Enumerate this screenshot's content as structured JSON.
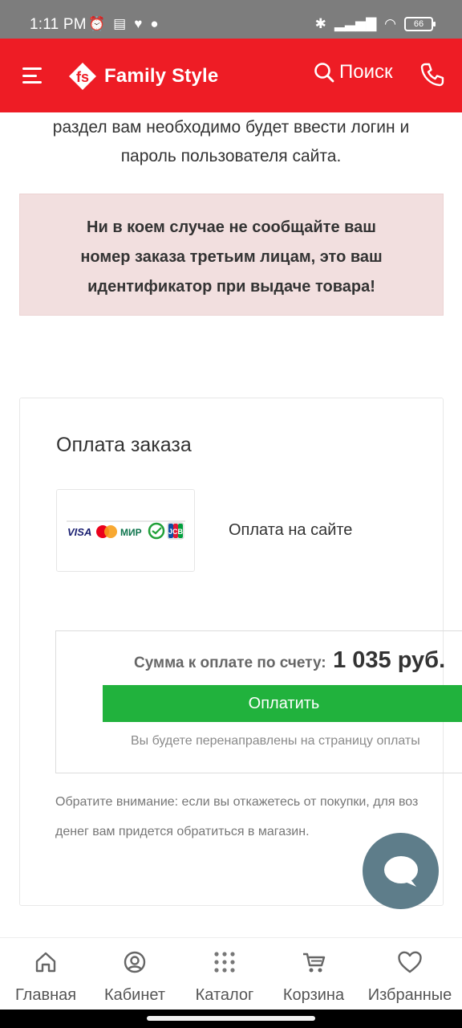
{
  "status_bar": {
    "time": "1:11 PM",
    "battery": "66"
  },
  "header": {
    "brand": "Family Style",
    "search_label": "Поиск"
  },
  "intro_text": {
    "line1": "раздел вам необходимо будет ввести логин и",
    "line2": "пароль пользователя сайта."
  },
  "alert": {
    "line1": "Ни в коем случае не сообщайте ваш",
    "line2": "номер заказа третьим лицам, это ваш",
    "line3": "идентификатор при выдаче товара!"
  },
  "payment": {
    "title": "Оплата заказа",
    "method_label": "Оплата на сайте",
    "card_brands": {
      "visa": "VISA",
      "mir": "МИР",
      "jcb": "JCB"
    },
    "total_label": "Сумма к оплате по счету:",
    "total_value": "1 035 руб.",
    "pay_button": "Оплатить",
    "redirect_note": "Вы будете перенаправлены на страницу оплаты",
    "notice_line1": "Обратите внимание: если вы откажетесь от покупки, для воз",
    "notice_line2": "денег вам придется обратиться в магазин."
  },
  "bottom_nav": {
    "items": [
      {
        "label": "Главная",
        "icon": "home-icon"
      },
      {
        "label": "Кабинет",
        "icon": "user-icon"
      },
      {
        "label": "Каталог",
        "icon": "grid-icon"
      },
      {
        "label": "Корзина",
        "icon": "cart-icon"
      },
      {
        "label": "Избранные",
        "icon": "heart-icon"
      }
    ]
  },
  "colors": {
    "header_red": "#ee1c25",
    "pay_green": "#21b23d",
    "alert_bg": "#f2dfdf",
    "chat_fab": "#5e7d8a"
  }
}
